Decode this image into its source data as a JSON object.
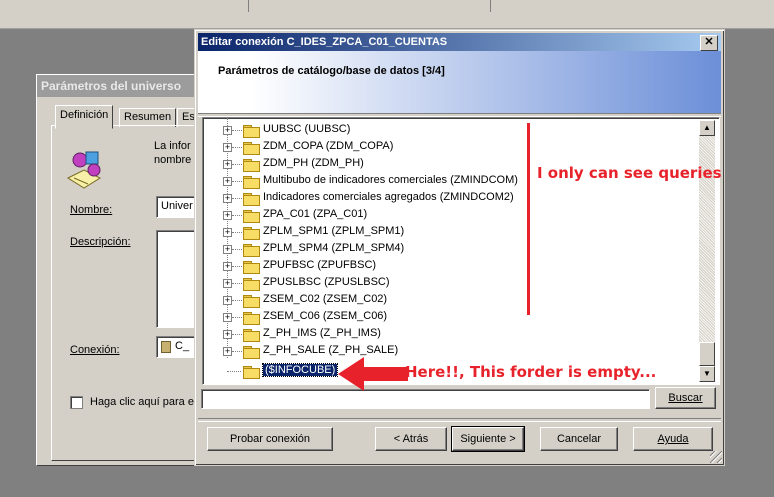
{
  "background_dialog": {
    "title": "Parámetros del universo",
    "tabs": [
      "Definición",
      "Resumen",
      "Es"
    ],
    "info_text_line1": "La infor",
    "info_text_line2": "nombre",
    "name_label": "Nombre:",
    "name_value": "Univer",
    "description_label": "Descripción:",
    "connection_label": "Conexión:",
    "connection_value": "C_",
    "checkbox_label": "Haga clic aquí para e"
  },
  "dialog": {
    "title": "Editar conexión C_IDES_ZPCA_C01_CUENTAS",
    "close_glyph": "✕",
    "header": "Parámetros de catálogo/base de datos [3/4]",
    "tree_items": [
      {
        "label": "UUBSC (UUBSC)",
        "expand": "+"
      },
      {
        "label": "ZDM_COPA (ZDM_COPA)",
        "expand": "+"
      },
      {
        "label": "ZDM_PH (ZDM_PH)",
        "expand": "+"
      },
      {
        "label": "Multibubo de indicadores comerciales (ZMINDCOM)",
        "expand": "+"
      },
      {
        "label": "Indicadores comerciales agregados (ZMINDCOM2)",
        "expand": "+"
      },
      {
        "label": "ZPA_C01 (ZPA_C01)",
        "expand": "+"
      },
      {
        "label": "ZPLM_SPM1 (ZPLM_SPM1)",
        "expand": "+"
      },
      {
        "label": "ZPLM_SPM4 (ZPLM_SPM4)",
        "expand": "+"
      },
      {
        "label": "ZPUFBSC (ZPUFBSC)",
        "expand": "+"
      },
      {
        "label": "ZPUSLBSC (ZPUSLBSC)",
        "expand": "+"
      },
      {
        "label": "ZSEM_C02 (ZSEM_C02)",
        "expand": "+"
      },
      {
        "label": "ZSEM_C06 (ZSEM_C06)",
        "expand": "+"
      },
      {
        "label": "Z_PH_IMS (Z_PH_IMS)",
        "expand": "+"
      },
      {
        "label": "Z_PH_SALE (Z_PH_SALE)",
        "expand": "+"
      }
    ],
    "selected_item": "($INFOCUBE)",
    "search_value": "",
    "buttons": {
      "search": "Buscar",
      "test": "Probar conexión",
      "back": "< Atrás",
      "next": "Siguiente >",
      "cancel": "Cancelar",
      "help": "Ayuda"
    }
  },
  "annotations": {
    "right_note": "I only can see queries",
    "arrow_note": "Here!!, This forder is empty...",
    "color": "#e8222a"
  }
}
